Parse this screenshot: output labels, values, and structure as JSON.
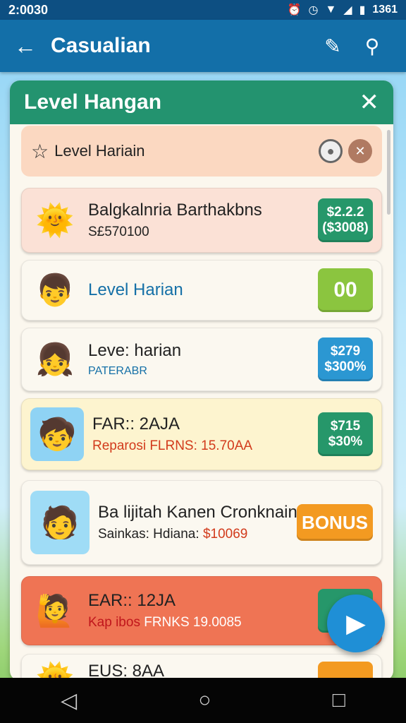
{
  "status_bar": {
    "time": "2:0030",
    "battery_text": "1361",
    "icons": [
      "alarm-icon",
      "clock-icon",
      "wifi-icon",
      "signal-icon",
      "battery-icon"
    ]
  },
  "app_bar": {
    "back_icon": "arrow-left-icon",
    "title": "Casualian",
    "action_icons": [
      "edit-icon",
      "user-icon"
    ]
  },
  "panel": {
    "title": "Level Hangan",
    "close_icon": "close-icon",
    "sub_header": {
      "title": "Level Hariain",
      "icons": [
        "star-icon",
        "radio-icon",
        "close-circle-icon"
      ]
    },
    "rows": [
      {
        "title": "Balgkalnria Barthakbns",
        "subtitle": "S£570100",
        "avatar_icon": "sun-icon",
        "price_top": "$2.2.2",
        "price_bottom": "($3008)",
        "bg": "#fbe1d6",
        "price_color": "#26976a"
      },
      {
        "title": "Level Harian",
        "subtitle": "",
        "avatar_icon": "boy-cap-icon",
        "badge": "00",
        "bg": "#fbf8f0",
        "title_color": "#1570a7",
        "badge_color": "#8bc53f"
      },
      {
        "title": "Leve: harian",
        "subtitle": "PATERABR",
        "avatar_icon": "girl-flower-icon",
        "price_top": "$279",
        "price_bottom": "$300%",
        "bg": "#fbf8f0",
        "subtitle_color": "#1570a7",
        "price_color": "#2b97d2"
      },
      {
        "title": "FAR:: 2AJA",
        "subtitle": "Reparosi FLRNS: 15.70AA",
        "avatar_icon": "shop-kid-icon",
        "price_top": "$715",
        "price_bottom": "$30%",
        "bg": "#fdf4cf",
        "subtitle_color": "#d23b1c",
        "price_color": "#26976a"
      },
      {
        "title": "Ba lijitah Kanen Cronknain",
        "subtitle_label": "Sainkas: Hdiana:",
        "subtitle_value": "$10069",
        "avatar_icon": "market-kid-icon",
        "button": "BONUS",
        "bg": "#fbf8f0",
        "subtitle_value_color": "#d23b1c"
      },
      {
        "title": "EAR:: 12JA",
        "subtitle_label": "Kap ibos",
        "subtitle_value": "FRNKS 19.0085",
        "avatar_icon": "boy-waving-icon",
        "bg": "#ef7454",
        "subtitle_label_color": "#c0161c",
        "subtitle_value_color": "#ffffff",
        "price_color": "#26976a"
      },
      {
        "title": "EUS: 8AA",
        "avatar_icon": "sun-icon",
        "bg": "#fbf8f0",
        "price_color": "#f39a21"
      }
    ]
  },
  "fab_icon": "play-icon",
  "nav_bar": {
    "icons": [
      "back-triangle-icon",
      "home-circle-icon",
      "recents-square-icon"
    ]
  },
  "colors": {
    "app_bar": "#136fa8",
    "panel_header": "#23936f",
    "fab": "#1f8fd6"
  }
}
